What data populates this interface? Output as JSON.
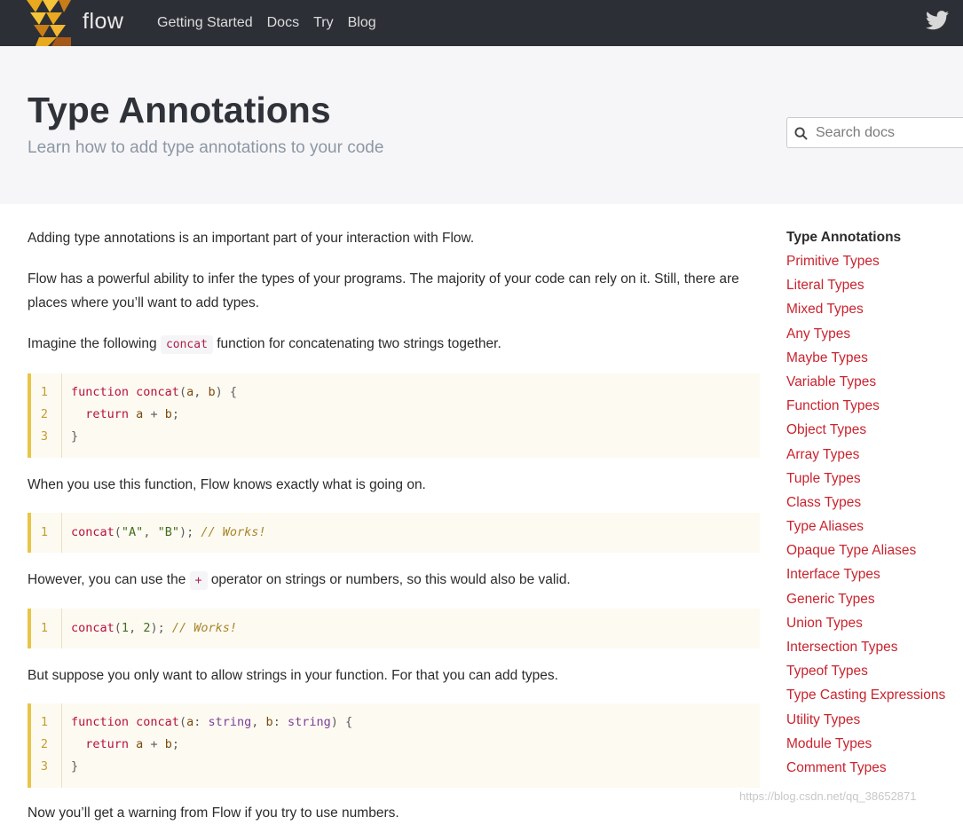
{
  "nav": {
    "logo_text": "flow",
    "links": [
      "Getting Started",
      "Docs",
      "Try",
      "Blog"
    ]
  },
  "hero": {
    "title": "Type Annotations",
    "subtitle": "Learn how to add type annotations to your code",
    "search_placeholder": "Search docs"
  },
  "content": {
    "p1": "Adding type annotations is an important part of your interaction with Flow.",
    "p2": "Flow has a powerful ability to infer the types of your programs. The majority of your code can rely on it. Still, there are places where you’ll want to add types.",
    "p3_before": "Imagine the following",
    "p3_code": "concat",
    "p3_after": "function for concatenating two strings together.",
    "p4": "When you use this function, Flow knows exactly what is going on.",
    "p5_before": "However, you can use the",
    "p5_code": "+",
    "p5_after": "operator on strings or numbers, so this would also be valid.",
    "p6": "But suppose you only want to allow strings in your function. For that you can add types.",
    "p7_partial": "Now you’ll get a warning from Flow if you try to use numbers."
  },
  "code": {
    "block1": [
      "function concat(a, b) {",
      "  return a + b;",
      "}"
    ],
    "block2": [
      "concat(\"A\", \"B\"); // Works!"
    ],
    "block3": [
      "concat(1, 2); // Works!"
    ],
    "block4": [
      "function concat(a: string, b: string) {",
      "  return a + b;",
      "}"
    ]
  },
  "sidebar": {
    "heading": "Type Annotations",
    "items": [
      "Primitive Types",
      "Literal Types",
      "Mixed Types",
      "Any Types",
      "Maybe Types",
      "Variable Types",
      "Function Types",
      "Object Types",
      "Array Types",
      "Tuple Types",
      "Class Types",
      "Type Aliases",
      "Opaque Type Aliases",
      "Interface Types",
      "Generic Types",
      "Union Types",
      "Intersection Types",
      "Typeof Types",
      "Type Casting Expressions",
      "Utility Types",
      "Module Types",
      "Comment Types"
    ]
  },
  "watermark": "https://blog.csdn.net/qq_38652871",
  "colors": {
    "nav_bg": "#2c2f36",
    "hero_bg": "#f6f6f8",
    "link": "#c9242f",
    "code_border": "#e8c547",
    "code_bg": "#fdfaf2"
  }
}
